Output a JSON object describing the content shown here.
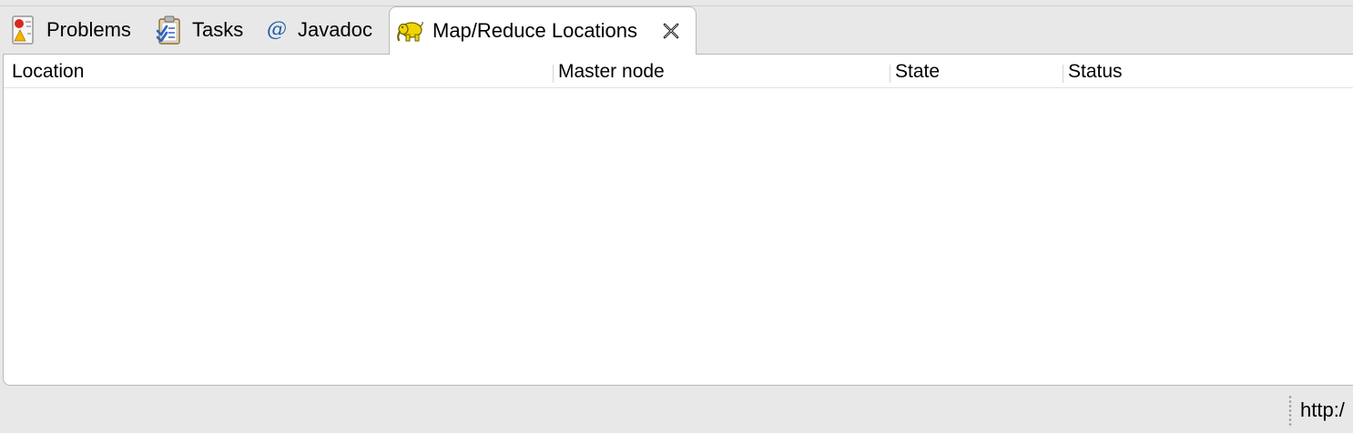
{
  "tabs": {
    "problems": {
      "label": "Problems",
      "icon": "problems-icon"
    },
    "tasks": {
      "label": "Tasks",
      "icon": "tasks-icon"
    },
    "javadoc": {
      "label": "Javadoc",
      "icon": "javadoc-at-icon",
      "glyph": "@"
    },
    "mapreduce": {
      "label": "Map/Reduce Locations",
      "icon": "hadoop-elephant-icon",
      "active": true
    }
  },
  "table": {
    "columns": [
      "Location",
      "Master node",
      "State",
      "Status"
    ],
    "rows": []
  },
  "statusbar": {
    "text": "http:/"
  },
  "colors": {
    "background": "#e8e8e8",
    "panel": "#ffffff",
    "border": "#b9b9b9",
    "javadoc_blue": "#1f5ea8",
    "elephant_yellow": "#f1d400"
  }
}
